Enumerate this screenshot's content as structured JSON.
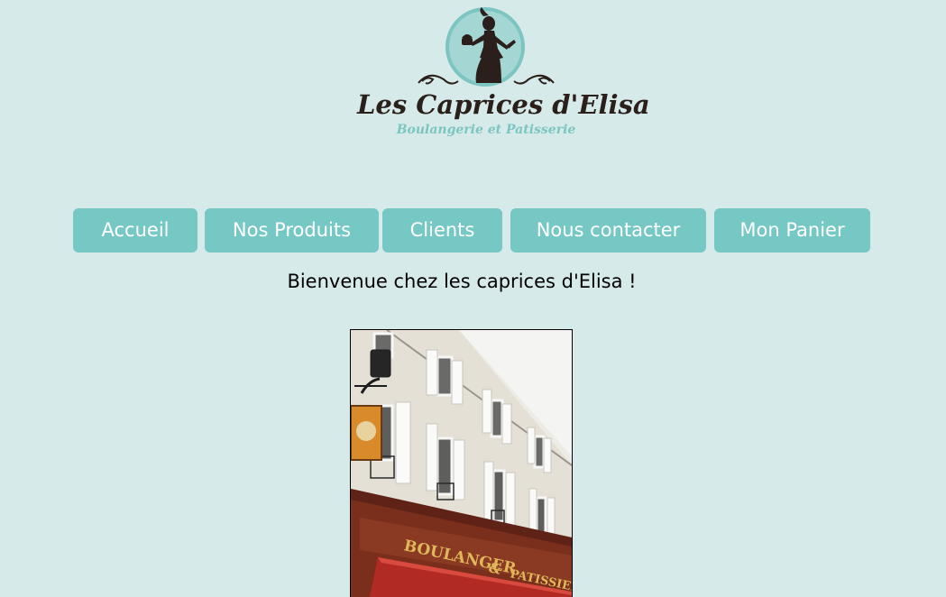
{
  "logo": {
    "brand": "Les Caprices d'Elisa",
    "tagline": "Boulangerie et Patisserie",
    "icon": "woman-with-cupcake-silhouette-icon"
  },
  "nav": {
    "items": [
      {
        "label": "Accueil"
      },
      {
        "label": "Nos Produits"
      },
      {
        "label": "Clients"
      },
      {
        "label": "Nous contacter"
      },
      {
        "label": "Mon Panier"
      }
    ]
  },
  "main": {
    "welcome": "Bienvenue chez les caprices d'Elisa !",
    "photo": {
      "sign_boulanger": "BOULANGER",
      "sign_patissier": "PATISSIER",
      "sign_ampersand": "&"
    }
  },
  "colors": {
    "background": "#d6eaea",
    "accent": "#76c8c4",
    "brand_text": "#2a1f1a"
  }
}
